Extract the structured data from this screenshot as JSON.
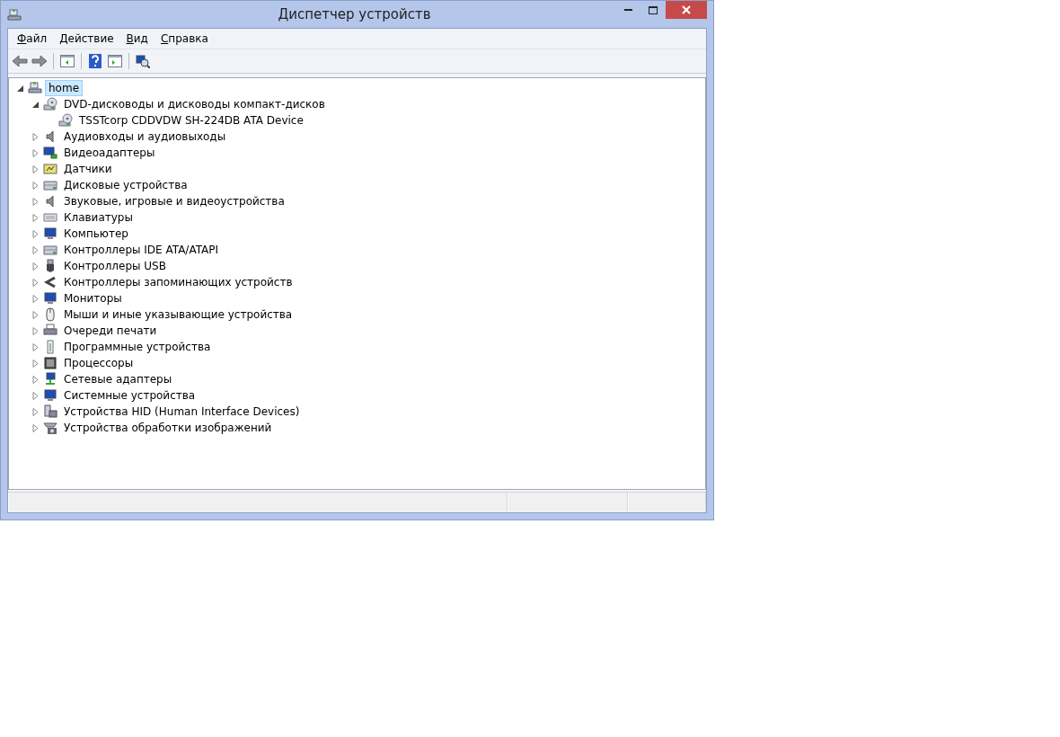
{
  "window": {
    "title": "Диспетчер устройств"
  },
  "menu": [
    {
      "label": "Файл"
    },
    {
      "label": "Действие"
    },
    {
      "label": "Вид"
    },
    {
      "label": "Справка"
    }
  ],
  "toolbar": [
    {
      "kind": "back",
      "disabled": false
    },
    {
      "kind": "forward",
      "disabled": false
    },
    {
      "kind": "separator"
    },
    {
      "kind": "tree"
    },
    {
      "kind": "separator"
    },
    {
      "kind": "help"
    },
    {
      "kind": "pane"
    },
    {
      "kind": "separator"
    },
    {
      "kind": "scan"
    }
  ],
  "tree": {
    "label": "home",
    "kind": "computer",
    "expanded": true,
    "selected": true,
    "children": [
      {
        "label": "DVD-дисководы и дисководы компакт-дисков",
        "kind": "dvd",
        "expanded": true,
        "selected": false,
        "children": [
          {
            "label": "TSSTcorp CDDVDW SH-224DB ATA Device",
            "kind": "dvd",
            "selected": false
          }
        ]
      },
      {
        "label": "Аудиовходы и аудиовыходы",
        "kind": "speaker",
        "expanded": false,
        "selected": false
      },
      {
        "label": "Видеоадаптеры",
        "kind": "display",
        "expanded": false,
        "selected": false
      },
      {
        "label": "Датчики",
        "kind": "sensor",
        "expanded": false,
        "selected": false
      },
      {
        "label": "Дисковые устройства",
        "kind": "disk",
        "expanded": false,
        "selected": false
      },
      {
        "label": "Звуковые, игровые и видеоустройства",
        "kind": "speaker",
        "expanded": false,
        "selected": false
      },
      {
        "label": "Клавиатуры",
        "kind": "keyboard",
        "expanded": false,
        "selected": false
      },
      {
        "label": "Компьютер",
        "kind": "monitor",
        "expanded": false,
        "selected": false
      },
      {
        "label": "Контроллеры IDE ATA/ATAPI",
        "kind": "disk",
        "expanded": false,
        "selected": false
      },
      {
        "label": "Контроллеры USB",
        "kind": "usb",
        "expanded": false,
        "selected": false
      },
      {
        "label": "Контроллеры запоминающих устройств",
        "kind": "storage",
        "expanded": false,
        "selected": false
      },
      {
        "label": "Мониторы",
        "kind": "monitor",
        "expanded": false,
        "selected": false
      },
      {
        "label": "Мыши и иные указывающие устройства",
        "kind": "mouse",
        "expanded": false,
        "selected": false
      },
      {
        "label": "Очереди печати",
        "kind": "printer",
        "expanded": false,
        "selected": false
      },
      {
        "label": "Программные устройства",
        "kind": "software",
        "expanded": false,
        "selected": false
      },
      {
        "label": "Процессоры",
        "kind": "chip",
        "expanded": false,
        "selected": false
      },
      {
        "label": "Сетевые адаптеры",
        "kind": "network",
        "expanded": false,
        "selected": false
      },
      {
        "label": "Системные устройства",
        "kind": "monitor",
        "expanded": false,
        "selected": false
      },
      {
        "label": "Устройства HID (Human Interface Devices)",
        "kind": "hid",
        "expanded": false,
        "selected": false
      },
      {
        "label": "Устройства обработки изображений",
        "kind": "camera",
        "expanded": false,
        "selected": false
      }
    ]
  }
}
